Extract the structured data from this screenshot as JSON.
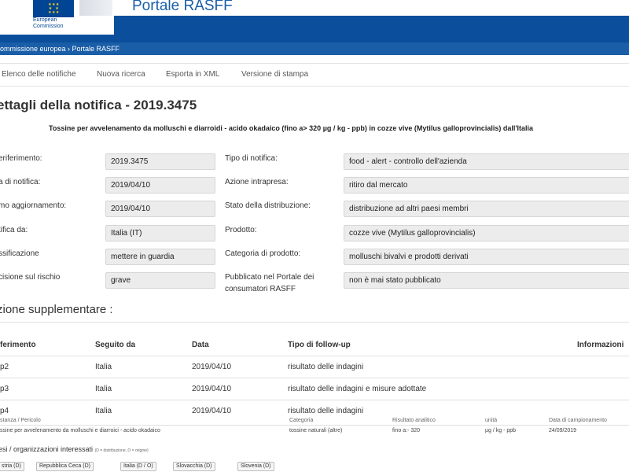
{
  "header": {
    "logo_line1": "European",
    "logo_line2": "Commission",
    "portal_title": "Portale RASFF"
  },
  "breadcrumb": {
    "text": "ommissione europea › Portale RASFF"
  },
  "nav": {
    "items": [
      "Elenco delle notifiche",
      "Nuova ricerca",
      "Esporta in XML",
      "Versione di stampa"
    ]
  },
  "page": {
    "title": "ettagli della notifica - 2019.3475",
    "subtitle": "Tossine per avvelenamento da molluschi e diarroidi - acido okadaico (fino a> 320 µg / kg - ppb) in cozze vive (Mytilus galloprovincialis) dall'Italia"
  },
  "fields_left": [
    {
      "label": "eriferimento:",
      "value": "2019.3475"
    },
    {
      "label": "a di notifica:",
      "value": "2019/04/10"
    },
    {
      "label": "mo aggiornamento:",
      "value": "2019/04/10"
    },
    {
      "label": "tifica da:",
      "value": "Italia (IT)"
    },
    {
      "label": "ssificazione",
      "value": "mettere in guardia"
    },
    {
      "label": "cisione sul rischio",
      "value": "grave"
    }
  ],
  "fields_right": [
    {
      "label": "Tipo di notifica:",
      "value": "food - alert - controllo dell'azienda"
    },
    {
      "label": "Azione intrapresa:",
      "value": "ritiro dal mercato"
    },
    {
      "label": "Stato della distribuzione:",
      "value": "distribuzione ad altri paesi membri"
    },
    {
      "label": "Prodotto:",
      "value": "cozze vive (Mytilus galloprovincialis)"
    },
    {
      "label": "Categoria di prodotto:",
      "value": "molluschi bivalvi e prodotti derivati"
    },
    {
      "label": "Pubblicato nel Portale dei",
      "label2": "consumatori RASFF",
      "value": "non è mai stato pubblicato"
    }
  ],
  "supplementary": {
    "title": "zione supplementare :",
    "headers": [
      "ferimento",
      "Seguito da",
      "Data",
      "Tipo di follow-up",
      "Informazioni"
    ],
    "rows": [
      [
        "p2",
        "Italia",
        "2019/04/10",
        "risultato delle indagini"
      ],
      [
        "p3",
        "Italia",
        "2019/04/10",
        "risultato delle indagini e misure adottate"
      ],
      [
        "p4",
        "Italia",
        "2019/04/10",
        "risultato delle indagini"
      ]
    ]
  },
  "hazards": {
    "headers": [
      "stanza / Pericolo",
      "Categoria",
      "Risultato analitico",
      "unità",
      "Data di campionamento"
    ],
    "row": [
      "ssine per avvelenamento da molluschi e diarroici - acido okadaico",
      "tossine naturali (altre)",
      "fino a:- 320",
      "µg / kg - ppb",
      "24/09/2019"
    ]
  },
  "countries": {
    "title": "esi / organizzazioni interessati",
    "legend": "(D = distribuzione, O = origine)",
    "tags": [
      "stria (D)",
      "Repubblica Ceca (D)",
      "Italia (D / O)",
      "Slovacchia (D)",
      "Slovenia (D)"
    ]
  }
}
